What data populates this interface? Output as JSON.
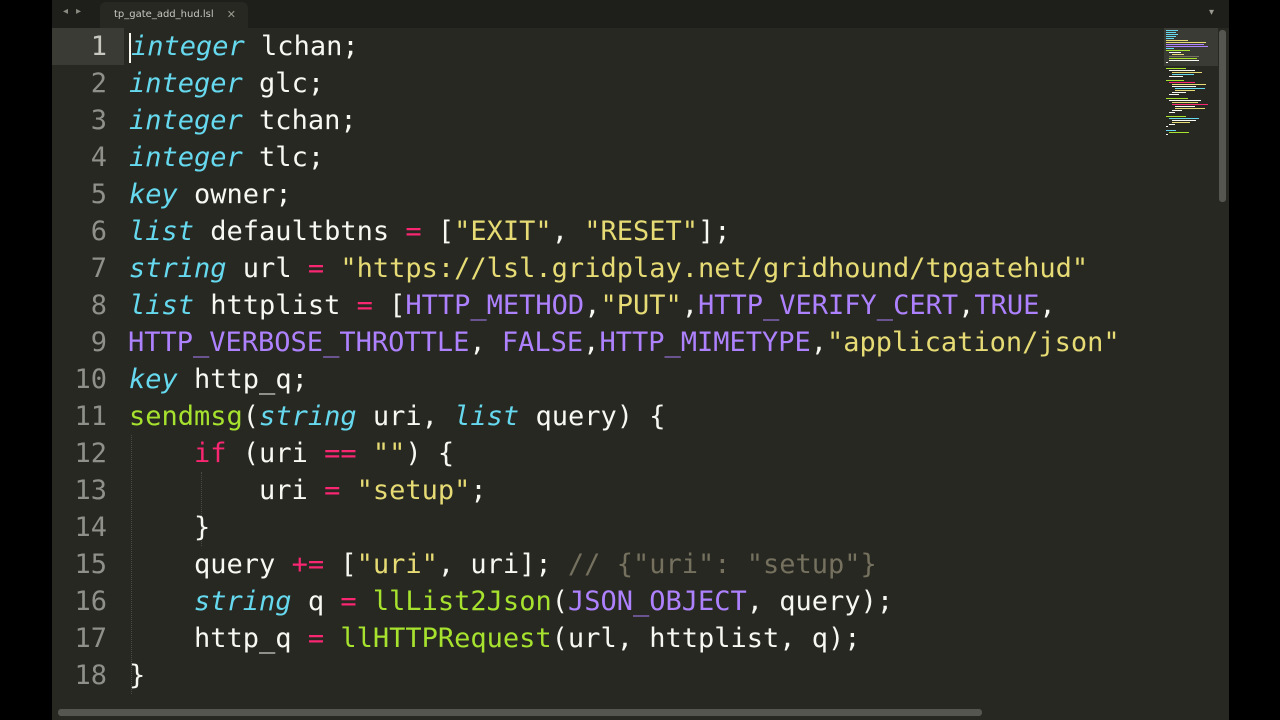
{
  "tabbar": {
    "back_glyph": "◂",
    "forward_glyph": "▸",
    "tab_title": "tp_gate_add_hud.lsl",
    "close_glyph": "✕",
    "dropdown_glyph": "▾"
  },
  "line_numbers": [
    "1",
    "2",
    "3",
    "4",
    "5",
    "6",
    "7",
    "8",
    "9",
    "10",
    "11",
    "12",
    "13",
    "14",
    "15",
    "16",
    "17",
    "18"
  ],
  "active_line": 1,
  "code": {
    "l1": [
      "integer",
      " lchan;"
    ],
    "l2": [
      "integer",
      " glc;"
    ],
    "l3": [
      "integer",
      " tchan;"
    ],
    "l4": [
      "integer",
      " tlc;"
    ],
    "l5": [
      "key",
      " owner;"
    ],
    "l6": [
      "list",
      " defaultbtns ",
      "=",
      " [",
      "\"EXIT\"",
      ", ",
      "\"RESET\"",
      "];"
    ],
    "l7": [
      "string",
      " url ",
      "=",
      " ",
      "\"https://lsl.gridplay.net/gridhound/tpgatehud\""
    ],
    "l8": [
      "list",
      " httplist ",
      "=",
      " [",
      "HTTP_METHOD",
      ",",
      "\"PUT\"",
      ",",
      "HTTP_VERIFY_CERT",
      ",",
      "TRUE",
      ","
    ],
    "l9": [
      "HTTP_VERBOSE_THROTTLE",
      ", ",
      "FALSE",
      ",",
      "HTTP_MIMETYPE",
      ",",
      "\"application/json\""
    ],
    "l10": [
      "key",
      " http_q;"
    ],
    "l11": [
      "sendmsg",
      "(",
      "string",
      " uri, ",
      "list",
      " query) {"
    ],
    "l12": [
      "    ",
      "if",
      " (uri ",
      "==",
      " ",
      "\"\"",
      ") {"
    ],
    "l13": [
      "        uri ",
      "=",
      " ",
      "\"setup\"",
      ";"
    ],
    "l14": [
      "    }"
    ],
    "l15": [
      "    query ",
      "+=",
      " [",
      "\"uri\"",
      ", uri]; ",
      "// {\"uri\": \"setup\"}"
    ],
    "l16": [
      "    ",
      "string",
      " q ",
      "=",
      " ",
      "llList2Json",
      "(",
      "JSON_OBJECT",
      ", query);"
    ],
    "l17": [
      "    http_q ",
      "=",
      " ",
      "llHTTPRequest",
      "(url, httplist, q);"
    ],
    "l18": [
      "}"
    ]
  },
  "colors": {
    "background": "#272822",
    "keyword": "#66d9ef",
    "string": "#e6db74",
    "operator": "#f92672",
    "constant": "#ae81ff",
    "function": "#a6e22e",
    "comment": "#75715e",
    "text": "#f8f8f2"
  },
  "minimap": {
    "visible": true
  },
  "scrollbars": {
    "vertical": true,
    "horizontal": true
  }
}
